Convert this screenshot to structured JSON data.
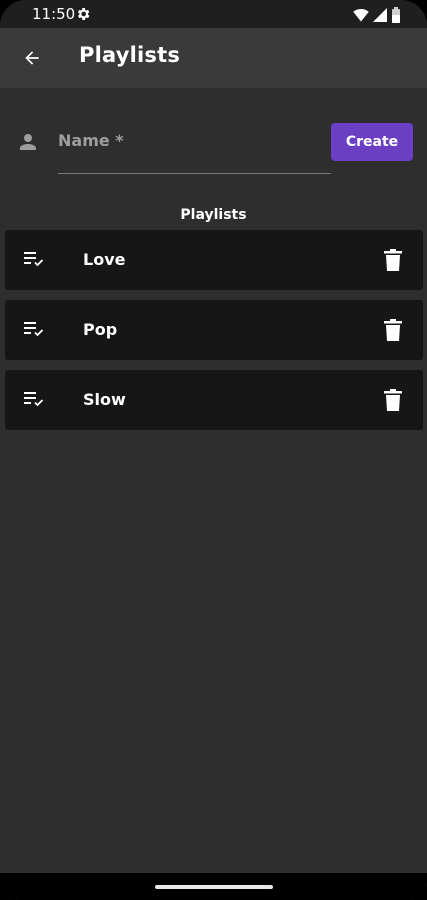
{
  "status_bar": {
    "time": "11:50",
    "icons": [
      "gear-icon",
      "wifi-icon",
      "signal-icon",
      "battery-icon"
    ]
  },
  "app_bar": {
    "title": "Playlists",
    "back_icon": "arrow-back-icon"
  },
  "form": {
    "name_label": "Name *",
    "name_value": "",
    "create_label": "Create"
  },
  "section": {
    "heading": "Playlists"
  },
  "playlists": [
    {
      "name": "Love"
    },
    {
      "name": "Pop"
    },
    {
      "name": "Slow"
    }
  ],
  "colors": {
    "background": "#2e2e2e",
    "app_bar": "#3a3a3a",
    "list_item": "#161616",
    "accent": "#6a3fc4",
    "text": "#ffffff",
    "muted_text": "#9e9e9e"
  }
}
